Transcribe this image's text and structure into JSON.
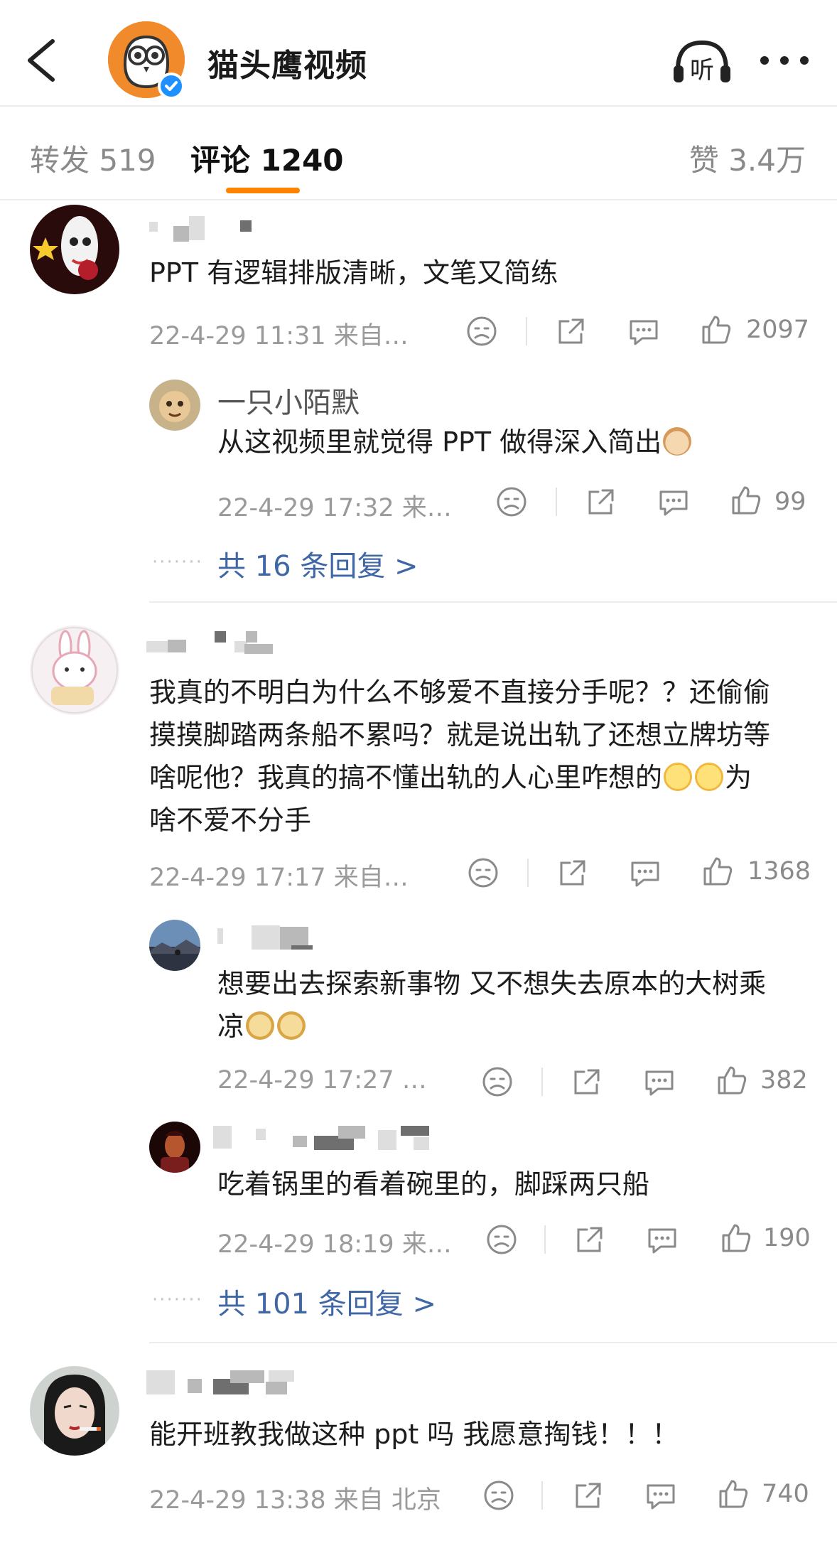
{
  "header": {
    "account_name": "猫头鹰视频",
    "listen_label": "听"
  },
  "tabs": {
    "forward": "转发 519",
    "comments": "评论 1240",
    "likes": "赞 3.4万"
  },
  "comments": [
    {
      "text": "PPT 有逻辑排版清晰，文笔又简练",
      "meta": "22-4-29 11:31  来自…",
      "likes": "2097",
      "replies": [
        {
          "name": "一只小陌默",
          "text": "从这视频里就觉得 PPT 做得深入简出",
          "meta": "22-4-29 17:32  来…",
          "likes": "99"
        }
      ],
      "more_replies": "共 16 条回复 >"
    },
    {
      "text_lines": [
        "我真的不明白为什么不够爱不直接分手呢？？还偷偷",
        "摸摸脚踏两条船不累吗？就是说出轨了还想立牌坊等",
        "啥呢他？我真的搞不懂出轨的人心里咋想的",
        "啥不爱不分手"
      ],
      "text_line3_tail": "为",
      "meta": "22-4-29 17:17  来自…",
      "likes": "1368",
      "replies": [
        {
          "text_lines": [
            "想要出去探索新事物 又不想失去原本的大树乘",
            "凉"
          ],
          "meta": "22-4-29 17:27  …",
          "likes": "382"
        },
        {
          "text": "吃着锅里的看着碗里的，脚踩两只船",
          "meta": "22-4-29 18:19  来…",
          "likes": "190"
        }
      ],
      "more_replies": "共 101 条回复 >"
    },
    {
      "text": "能开班教我做这种 ppt 吗 我愿意掏钱！！！",
      "meta": "22-4-29 13:38  来自 北京",
      "likes": "740"
    }
  ],
  "colors": {
    "accent": "#ff8200",
    "link": "#3f66a5",
    "verified": "#1e90ff"
  }
}
